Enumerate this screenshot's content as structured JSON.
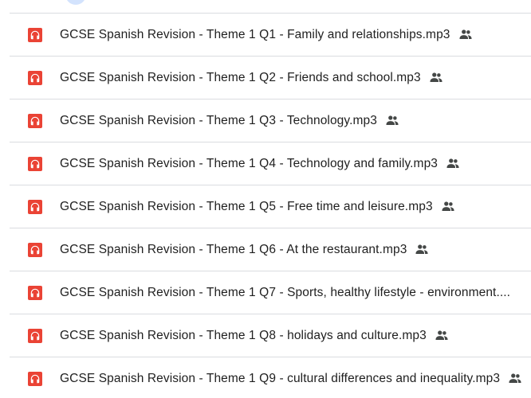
{
  "files": [
    {
      "name": "GCSE Spanish Revision - Theme 1 Q1 - Family and relationships.mp3",
      "icon": "audio-file-icon",
      "shared": true,
      "truncated": false
    },
    {
      "name": "GCSE Spanish Revision - Theme 1 Q2 - Friends and school.mp3",
      "icon": "audio-file-icon",
      "shared": true,
      "truncated": false
    },
    {
      "name": "GCSE Spanish Revision - Theme 1 Q3 - Technology.mp3",
      "icon": "audio-file-icon",
      "shared": true,
      "truncated": false
    },
    {
      "name": "GCSE Spanish Revision - Theme 1 Q4 - Technology and family.mp3",
      "icon": "audio-file-icon",
      "shared": true,
      "truncated": false
    },
    {
      "name": "GCSE Spanish Revision - Theme 1 Q5 - Free time and leisure.mp3",
      "icon": "audio-file-icon",
      "shared": true,
      "truncated": false
    },
    {
      "name": "GCSE Spanish Revision - Theme 1 Q6 - At the restaurant.mp3",
      "icon": "audio-file-icon",
      "shared": true,
      "truncated": false
    },
    {
      "name": "GCSE Spanish Revision - Theme 1 Q7 - Sports, healthy lifestyle - environment....",
      "icon": "audio-file-icon",
      "shared": false,
      "truncated": true
    },
    {
      "name": "GCSE Spanish Revision - Theme 1 Q8 - holidays and culture.mp3",
      "icon": "audio-file-icon",
      "shared": true,
      "truncated": false
    },
    {
      "name": "GCSE Spanish Revision - Theme 1 Q9 - cultural differences and inequality.mp3",
      "icon": "audio-file-icon",
      "shared": true,
      "truncated": false
    }
  ],
  "colors": {
    "audio_icon": "#ea4335",
    "divider": "#dadce0",
    "text": "#1f1f1f",
    "shared_icon": "#444746"
  }
}
